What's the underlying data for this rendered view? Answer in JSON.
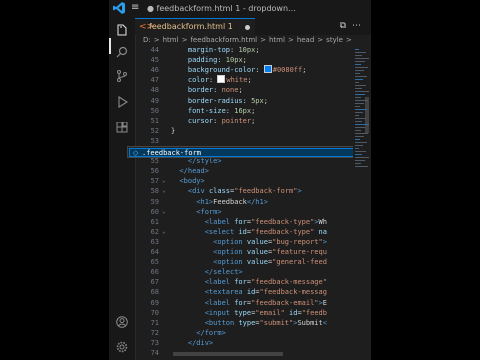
{
  "titlebar": {
    "title": "● feedbackform.html 1 - dropdown..."
  },
  "tab": {
    "name": "feedbackform.html 1"
  },
  "breadcrumb": [
    "D:",
    ">",
    "html",
    ">",
    "feedbackform.html",
    ">",
    "html",
    ">",
    "head",
    ">",
    "style",
    ">"
  ],
  "suggestion": {
    "label": ".feedback-form"
  },
  "colors": {
    "accent": "#0078d4",
    "editor_bg": "#1e1e1e"
  },
  "icons": [
    "explorer-icon",
    "search-icon",
    "source-control-icon",
    "run-debug-icon",
    "extensions-icon",
    "account-icon",
    "settings-gear-icon"
  ],
  "lines": [
    {
      "n": "44",
      "fold": "",
      "indent": 0,
      "seg": [
        [
          "p",
          "    margin-top"
        ],
        [
          "w",
          ": "
        ],
        [
          "n",
          "10px"
        ],
        [
          "w",
          ";"
        ]
      ]
    },
    {
      "n": "45",
      "fold": "",
      "indent": 0,
      "seg": [
        [
          "p",
          "    padding"
        ],
        [
          "w",
          ": "
        ],
        [
          "n",
          "10px"
        ],
        [
          "w",
          ";"
        ]
      ]
    },
    {
      "n": "46",
      "fold": "",
      "indent": 0,
      "seg": [
        [
          "p",
          "    background-color"
        ],
        [
          "w",
          ": "
        ],
        [
          "swatch",
          "#0080ff"
        ],
        [
          "v",
          "#0080ff"
        ],
        [
          "w",
          ";"
        ]
      ]
    },
    {
      "n": "47",
      "fold": "",
      "indent": 0,
      "seg": [
        [
          "p",
          "    color"
        ],
        [
          "w",
          ": "
        ],
        [
          "swatch",
          "#ffffff"
        ],
        [
          "v",
          "white"
        ],
        [
          "w",
          ";"
        ]
      ]
    },
    {
      "n": "48",
      "fold": "",
      "indent": 0,
      "seg": [
        [
          "p",
          "    border"
        ],
        [
          "w",
          ": "
        ],
        [
          "v",
          "none"
        ],
        [
          "w",
          ";"
        ]
      ]
    },
    {
      "n": "49",
      "fold": "",
      "indent": 0,
      "seg": [
        [
          "p",
          "    border-radius"
        ],
        [
          "w",
          ": "
        ],
        [
          "n",
          "5px"
        ],
        [
          "w",
          ";"
        ]
      ]
    },
    {
      "n": "50",
      "fold": "",
      "indent": 0,
      "seg": [
        [
          "p",
          "    font-size"
        ],
        [
          "w",
          ": "
        ],
        [
          "n",
          "16px"
        ],
        [
          "w",
          ";"
        ]
      ]
    },
    {
      "n": "51",
      "fold": "",
      "indent": 0,
      "seg": [
        [
          "p",
          "    cursor"
        ],
        [
          "w",
          ": "
        ],
        [
          "v",
          "pointer"
        ],
        [
          "w",
          ";"
        ]
      ]
    },
    {
      "n": "52",
      "fold": "",
      "indent": 0,
      "seg": [
        [
          "w",
          "}"
        ]
      ]
    },
    {
      "n": "53",
      "fold": "",
      "indent": 0,
      "seg": [
        [
          "w",
          ""
        ]
      ]
    },
    {
      "n": "54",
      "fold": "",
      "indent": 0,
      "seg": [
        [
          "w",
          ""
        ]
      ]
    },
    {
      "n": "55",
      "fold": "",
      "indent": 0,
      "seg": [
        [
          "t",
          "    </style>"
        ]
      ]
    },
    {
      "n": "56",
      "fold": "",
      "indent": 0,
      "seg": [
        [
          "t",
          "  </head>"
        ]
      ]
    },
    {
      "n": "57",
      "fold": "⌄",
      "indent": 0,
      "seg": [
        [
          "t",
          "  <body>"
        ]
      ]
    },
    {
      "n": "58",
      "fold": "⌄",
      "indent": 0,
      "seg": [
        [
          "t",
          "    <div "
        ],
        [
          "a",
          "class"
        ],
        [
          "w",
          "="
        ],
        [
          "s",
          "\"feedback-form\""
        ],
        [
          "t",
          ">"
        ]
      ]
    },
    {
      "n": "59",
      "fold": "",
      "indent": 0,
      "seg": [
        [
          "t",
          "      <h1>"
        ],
        [
          "w",
          "Feedback"
        ],
        [
          "t",
          "</h1>"
        ]
      ]
    },
    {
      "n": "60",
      "fold": "⌄",
      "indent": 0,
      "seg": [
        [
          "t",
          "      <form>"
        ]
      ]
    },
    {
      "n": "61",
      "fold": "",
      "indent": 0,
      "seg": [
        [
          "t",
          "        <label "
        ],
        [
          "a",
          "for"
        ],
        [
          "w",
          "="
        ],
        [
          "s",
          "\"feedback-type\""
        ],
        [
          "t",
          ">"
        ],
        [
          "w",
          "Wh"
        ]
      ]
    },
    {
      "n": "62",
      "fold": "⌄",
      "indent": 0,
      "seg": [
        [
          "t",
          "        <select "
        ],
        [
          "a",
          "id"
        ],
        [
          "w",
          "="
        ],
        [
          "s",
          "\"feedback-type\""
        ],
        [
          "a",
          " na"
        ]
      ]
    },
    {
      "n": "63",
      "fold": "",
      "indent": 0,
      "seg": [
        [
          "t",
          "          <option "
        ],
        [
          "a",
          "value"
        ],
        [
          "w",
          "="
        ],
        [
          "s",
          "\"bug-report\""
        ],
        [
          "t",
          ">"
        ]
      ]
    },
    {
      "n": "64",
      "fold": "",
      "indent": 0,
      "seg": [
        [
          "t",
          "          <option "
        ],
        [
          "a",
          "value"
        ],
        [
          "w",
          "="
        ],
        [
          "s",
          "\"feature-requ"
        ]
      ]
    },
    {
      "n": "65",
      "fold": "",
      "indent": 0,
      "seg": [
        [
          "t",
          "          <option "
        ],
        [
          "a",
          "value"
        ],
        [
          "w",
          "="
        ],
        [
          "s",
          "\"general-feed"
        ]
      ]
    },
    {
      "n": "66",
      "fold": "",
      "indent": 0,
      "seg": [
        [
          "t",
          "        </select>"
        ]
      ]
    },
    {
      "n": "67",
      "fold": "",
      "indent": 0,
      "seg": [
        [
          "t",
          "        <label "
        ],
        [
          "a",
          "for"
        ],
        [
          "w",
          "="
        ],
        [
          "s",
          "\"feedback-message\""
        ]
      ]
    },
    {
      "n": "68",
      "fold": "",
      "indent": 0,
      "seg": [
        [
          "t",
          "        <textarea "
        ],
        [
          "a",
          "id"
        ],
        [
          "w",
          "="
        ],
        [
          "s",
          "\"feedback-messag"
        ]
      ]
    },
    {
      "n": "69",
      "fold": "",
      "indent": 0,
      "seg": [
        [
          "t",
          "        <label "
        ],
        [
          "a",
          "for"
        ],
        [
          "w",
          "="
        ],
        [
          "s",
          "\"feedback-email\""
        ],
        [
          "t",
          ">"
        ],
        [
          "w",
          "E"
        ]
      ]
    },
    {
      "n": "70",
      "fold": "",
      "indent": 0,
      "seg": [
        [
          "t",
          "        <input "
        ],
        [
          "a",
          "type"
        ],
        [
          "w",
          "="
        ],
        [
          "s",
          "\"email\""
        ],
        [
          "a",
          " id"
        ],
        [
          "w",
          "="
        ],
        [
          "s",
          "\"feedb"
        ]
      ]
    },
    {
      "n": "71",
      "fold": "",
      "indent": 0,
      "seg": [
        [
          "t",
          "        <button "
        ],
        [
          "a",
          "type"
        ],
        [
          "w",
          "="
        ],
        [
          "s",
          "\"submit\""
        ],
        [
          "t",
          ">"
        ],
        [
          "w",
          "Submit"
        ],
        [
          "t",
          "<"
        ]
      ]
    },
    {
      "n": "72",
      "fold": "",
      "indent": 0,
      "seg": [
        [
          "t",
          "      </form>"
        ]
      ]
    },
    {
      "n": "73",
      "fold": "",
      "indent": 0,
      "seg": [
        [
          "t",
          "    </div>"
        ]
      ]
    },
    {
      "n": "74",
      "fold": "",
      "indent": 0,
      "seg": [
        [
          "w",
          ""
        ]
      ]
    }
  ]
}
